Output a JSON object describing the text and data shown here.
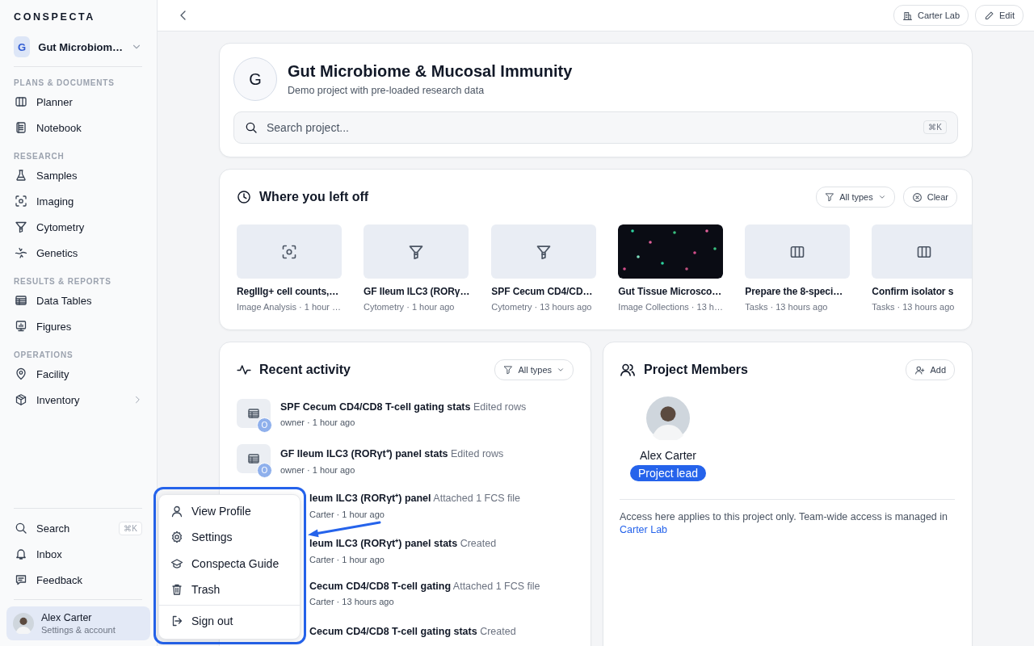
{
  "sidebar": {
    "logo": "CONSPECTA",
    "project": {
      "initial": "G",
      "name": "Gut Microbiom…"
    },
    "sections": [
      {
        "label": "PLANS & DOCUMENTS",
        "items": [
          {
            "label": "Planner",
            "submenu": false
          },
          {
            "label": "Notebook",
            "submenu": false
          }
        ]
      },
      {
        "label": "RESEARCH",
        "items": [
          {
            "label": "Samples",
            "submenu": false
          },
          {
            "label": "Imaging",
            "submenu": false
          },
          {
            "label": "Cytometry",
            "submenu": false
          },
          {
            "label": "Genetics",
            "submenu": false
          }
        ]
      },
      {
        "label": "RESULTS & REPORTS",
        "items": [
          {
            "label": "Data Tables",
            "submenu": false
          },
          {
            "label": "Figures",
            "submenu": false
          }
        ]
      },
      {
        "label": "OPERATIONS",
        "items": [
          {
            "label": "Facility",
            "submenu": false
          },
          {
            "label": "Inventory",
            "submenu": true
          }
        ]
      }
    ],
    "bottom_items": [
      {
        "label": "Search",
        "shortcut": "⌘K"
      },
      {
        "label": "Inbox"
      },
      {
        "label": "Feedback"
      }
    ],
    "account": {
      "name": "Alex Carter",
      "subtitle": "Settings & account",
      "selected": true
    }
  },
  "account_menu": {
    "items": [
      {
        "label": "View Profile",
        "separated": false
      },
      {
        "label": "Settings",
        "separated": false
      },
      {
        "label": "Conspecta Guide",
        "separated": false
      },
      {
        "label": "Trash",
        "separated": false
      },
      {
        "label": "Sign out",
        "separated": true
      }
    ]
  },
  "top_bar": {
    "buttons": [
      {
        "label": "Carter Lab"
      },
      {
        "label": "Edit"
      }
    ]
  },
  "project": {
    "initial": "G",
    "title": "Gut Microbiome & Mucosal Immunity",
    "subtitle": "Demo project with pre-loaded research data",
    "search": {
      "placeholder": "Search project...",
      "shortcut": "⌘K"
    }
  },
  "recent": {
    "title": "Where you left off",
    "filter": "All types",
    "clear": "Clear",
    "items": [
      {
        "kind": "imaging",
        "title": "RegIIIg+ cell counts,…",
        "meta": "Image Analysis · 1 hour …"
      },
      {
        "kind": "cytometry",
        "title": "GF Ileum ILC3 (RORγ…",
        "meta": "Cytometry · 1 hour ago"
      },
      {
        "kind": "cytometry",
        "title": "SPF Cecum CD4/CD…",
        "meta": "Cytometry · 13 hours ago"
      },
      {
        "kind": "picture",
        "title": "Gut Tissue Microsco…",
        "meta": "Image Collections · 13 h…"
      },
      {
        "kind": "tasks",
        "title": "Prepare the 8-speci…",
        "meta": "Tasks · 13 hours ago"
      },
      {
        "kind": "tasks",
        "title": "Confirm isolator s",
        "meta": "Tasks · 13 hours ago"
      }
    ]
  },
  "activity": {
    "title": "Recent activity",
    "filter": "All types",
    "rows": [
      {
        "covered": false,
        "avatar": "O",
        "text": "**SPF Cecum CD4/CD8 T-cell gating stats** Edited rows",
        "meta": "owner · 1 hour ago"
      },
      {
        "covered": false,
        "avatar": "O",
        "text": "**GF Ileum ILC3 (RORγt⁺) panel stats** Edited rows",
        "meta": "owner · 1 hour ago"
      },
      {
        "covered": true,
        "text": "**leum ILC3 (RORγt⁺) panel** Attached 1 FCS file",
        "meta": "Carter · 1 hour ago"
      },
      {
        "covered": true,
        "text": "**leum ILC3 (RORγt⁺) panel stats** Created",
        "meta": "Carter · 1 hour ago"
      },
      {
        "covered": true,
        "text": "**Cecum CD4/CD8 T-cell gating** Attached 1 FCS file",
        "meta": "Carter · 13 hours ago"
      },
      {
        "covered": true,
        "text": "**Cecum CD4/CD8 T-cell gating stats** Created"
      }
    ]
  },
  "members": {
    "title": "Project Members",
    "add": "Add",
    "people": [
      {
        "name": "Alex Carter",
        "role": "Project lead"
      }
    ],
    "note": "Access here applies to this project only. Team-wide access is managed in",
    "link": "Carter Lab"
  }
}
